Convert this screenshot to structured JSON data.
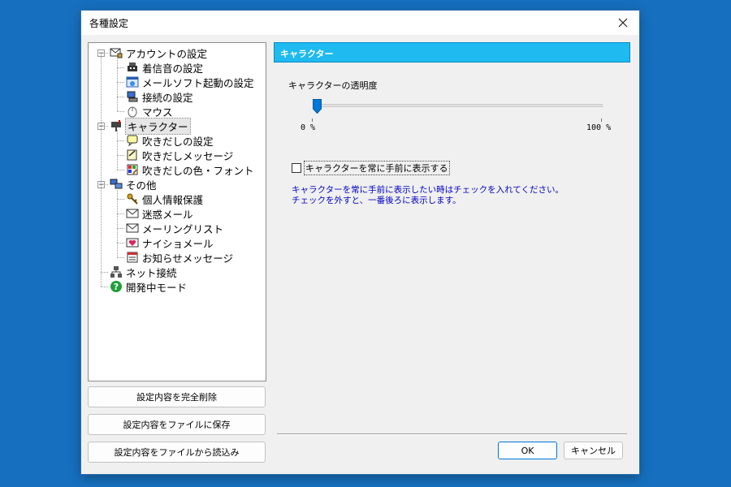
{
  "window": {
    "title": "各種設定"
  },
  "tree": {
    "items": [
      {
        "label": "アカウントの設定",
        "icon": "mail-lock-icon",
        "level": 0,
        "expander": "minus"
      },
      {
        "label": "着信音の設定",
        "icon": "phone-icon",
        "level": 1
      },
      {
        "label": "メールソフト起動の設定",
        "icon": "app-window-icon",
        "level": 1
      },
      {
        "label": "接続の設定",
        "icon": "network-computer-icon",
        "level": 1
      },
      {
        "label": "マウス",
        "icon": "mouse-icon",
        "level": 1
      },
      {
        "label": "キャラクター",
        "icon": "mailbox-icon",
        "level": 0,
        "expander": "minus",
        "selected": true
      },
      {
        "label": "吹きだしの設定",
        "icon": "speech-bubble-icon",
        "level": 1
      },
      {
        "label": "吹きだしメッセージ",
        "icon": "edit-note-icon",
        "level": 1
      },
      {
        "label": "吹きだしの色・フォント",
        "icon": "palette-icon",
        "level": 1
      },
      {
        "label": "その他",
        "icon": "computers-icon",
        "level": 0,
        "expander": "minus"
      },
      {
        "label": "個人情報保護",
        "icon": "keys-icon",
        "level": 1
      },
      {
        "label": "迷惑メール",
        "icon": "envelope-icon",
        "level": 1
      },
      {
        "label": "メーリングリスト",
        "icon": "envelope-icon",
        "level": 1
      },
      {
        "label": "ナイショメール",
        "icon": "heart-envelope-icon",
        "level": 1
      },
      {
        "label": "お知らせメッセージ",
        "icon": "notice-calendar-icon",
        "level": 1
      },
      {
        "label": "ネット接続",
        "icon": "network-icon",
        "level": 0
      },
      {
        "label": "開発中モード",
        "icon": "help-circle-icon",
        "level": 0
      }
    ]
  },
  "left_buttons": {
    "delete_all": "設定内容を完全削除",
    "save_file": "設定内容をファイルに保存",
    "load_file": "設定内容をファイルから読込み"
  },
  "panel": {
    "header": "キャラクター",
    "opacity_label": "キャラクターの透明度",
    "slider": {
      "min_label": "0 %",
      "max_label": "100 %",
      "value_percent": 0
    },
    "always_on_top": {
      "label": "キャラクターを常に手前に表示する",
      "checked": false
    },
    "info_line1": "キャラクターを常に手前に表示したい時はチェックを入れてください。",
    "info_line2": "チェックを外すと、一番後ろに表示します。"
  },
  "footer": {
    "ok": "OK",
    "cancel": "キャンセル"
  },
  "colors": {
    "header_bg": "#1ebaf0",
    "info_text": "#0000c8",
    "desktop": "#1670bf"
  }
}
